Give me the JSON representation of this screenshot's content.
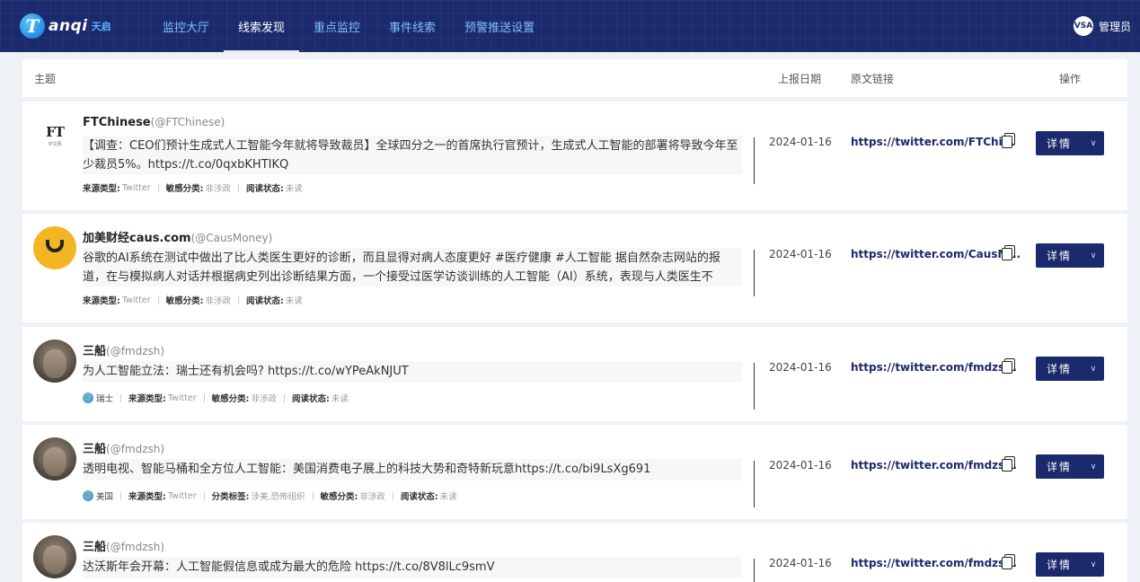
{
  "app": {
    "logo_letter": "T",
    "logo_text": "anqi",
    "logo_cn": "天启"
  },
  "nav": [
    {
      "label": "监控大厅"
    },
    {
      "label": "线索发现"
    },
    {
      "label": "重点监控"
    },
    {
      "label": "事件线索"
    },
    {
      "label": "预警推送设置"
    }
  ],
  "user": {
    "avatar_text": "VSA",
    "name": "管理员"
  },
  "table": {
    "headers": {
      "topic": "主题",
      "date": "上报日期",
      "link": "原文链接",
      "op": "操作"
    }
  },
  "rows": [
    {
      "name": "FTChinese",
      "handle": "(@FTChinese)",
      "ft_letters": "FT",
      "ft_side": "中文网",
      "content": "【调查：CEO们预计生成式人工智能今年就将导致裁员】全球四分之一的首席执行官预计，生成式人工智能的部署将导致今年至少裁员5%。https://t.co/0qxbKHTIKQ",
      "source_label": "来源类型:",
      "source": "Twitter",
      "sens_label": "敏感分类:",
      "sens": "非涉政",
      "read_label": "阅读状态:",
      "read": "未读",
      "date": "2024-01-16",
      "link": "https://twitter.com/FTChi...",
      "btn": "详情"
    },
    {
      "name": "加美财经caus.com",
      "handle": "(@CausMoney)",
      "content": "谷歌的AI系统在测试中做出了比人类医生更好的诊断，而且显得对病人态度更好 #医疗健康 #人工智能 据自然杂志网站的报道，在与模拟病人对话并根据病史列出诊断结果方面，一个接受过医学访谈训练的人工智能（AI）系统，表现与人类医生不",
      "source_label": "来源类型:",
      "source": "Twitter",
      "sens_label": "敏感分类:",
      "sens": "非涉政",
      "read_label": "阅读状态:",
      "read": "未读",
      "date": "2024-01-16",
      "link": "https://twitter.com/CausM...",
      "btn": "详情"
    },
    {
      "name": "三船",
      "handle": "(@fmdzsh)",
      "content": "为人工智能立法：瑞士还有机会吗? https://t.co/wYPeAkNJUT",
      "region": "瑞士",
      "source_label": "来源类型:",
      "source": "Twitter",
      "sens_label": "敏感分类:",
      "sens": "非涉政",
      "read_label": "阅读状态:",
      "read": "未读",
      "date": "2024-01-16",
      "link": "https://twitter.com/fmdzs...",
      "btn": "详情"
    },
    {
      "name": "三船",
      "handle": "(@fmdzsh)",
      "content": "透明电视、智能马桶和全方位人工智能：美国消费电子展上的科技大势和奇特新玩意https://t.co/bi9LsXg691",
      "region": "美国",
      "source_label": "来源类型:",
      "source": "Twitter",
      "tag_label": "分类标签:",
      "tag": "涉美,恐怖组织",
      "sens_label": "敏感分类:",
      "sens": "非涉政",
      "read_label": "阅读状态:",
      "read": "未读",
      "date": "2024-01-16",
      "link": "https://twitter.com/fmdzs...",
      "btn": "详情"
    },
    {
      "name": "三船",
      "handle": "(@fmdzsh)",
      "content": "达沃斯年会开幕：人工智能假信息或成为最大的危险 https://t.co/8V8lLc9smV",
      "date": "2024-01-16",
      "link": "https://twitter.com/fmdzs...",
      "btn": "详情"
    }
  ]
}
